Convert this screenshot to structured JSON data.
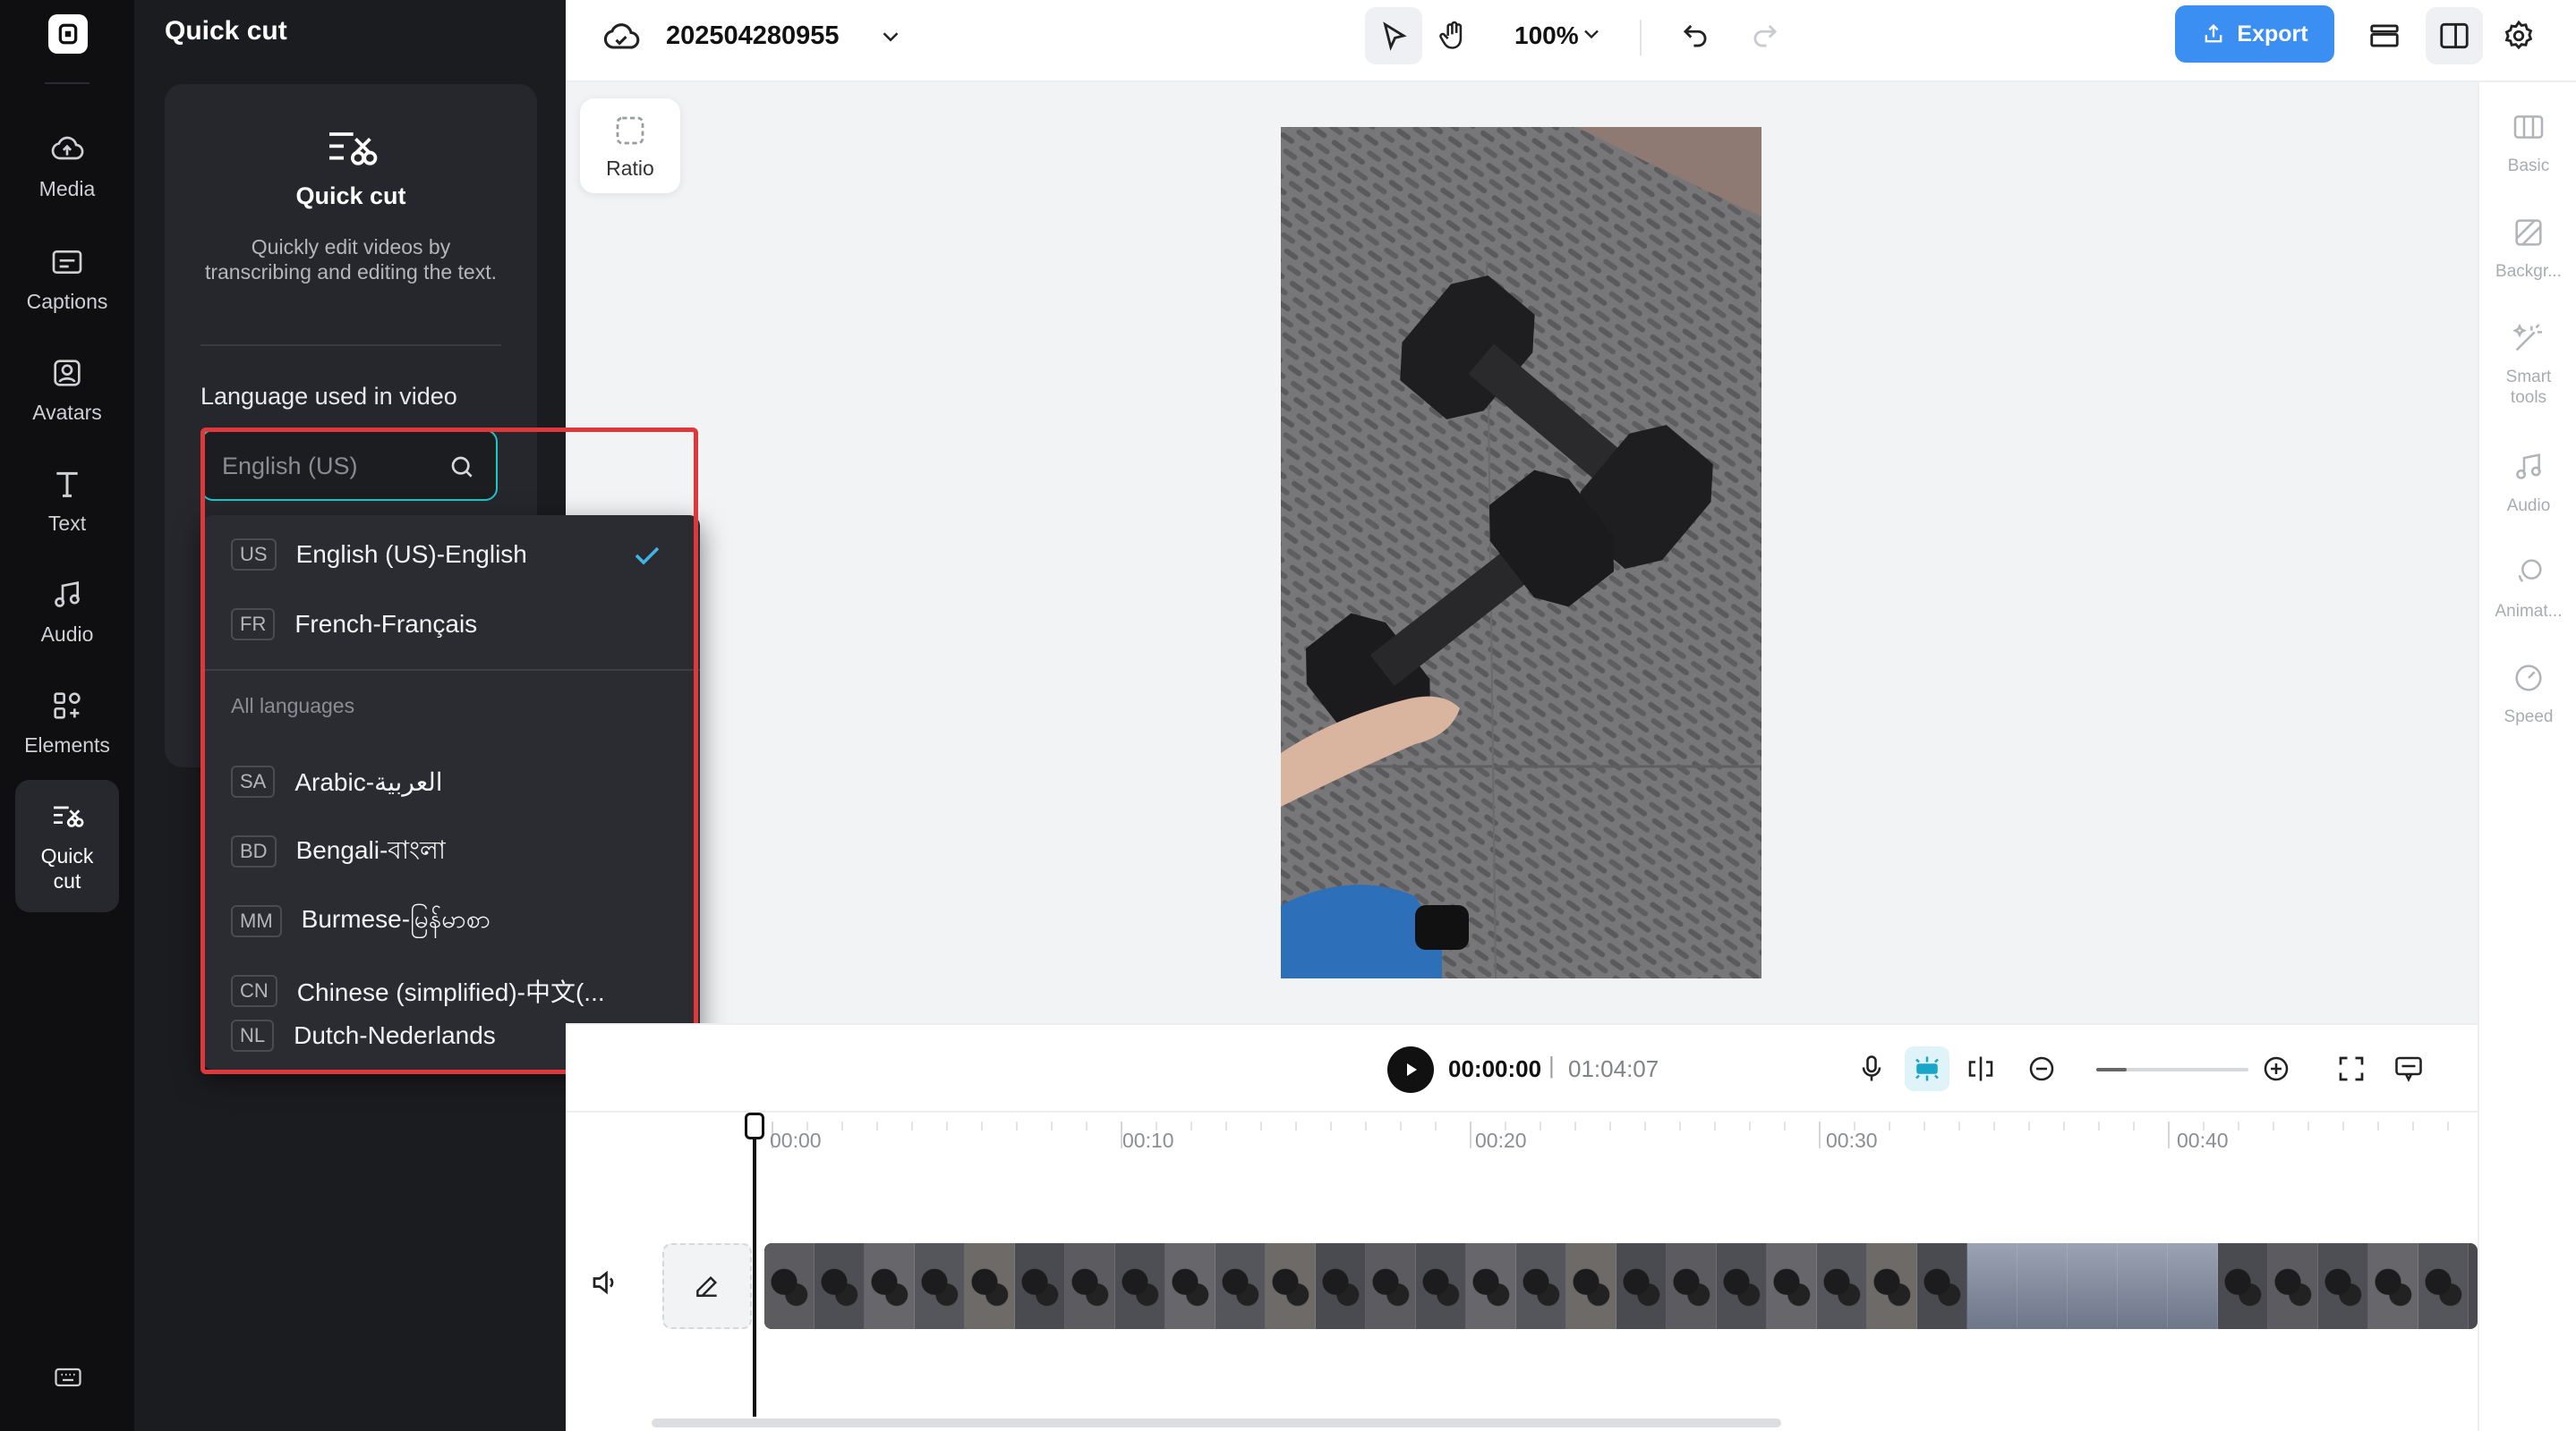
{
  "rail": {
    "items": [
      {
        "label": "Media",
        "icon": "cloud-upload-icon"
      },
      {
        "label": "Captions",
        "icon": "captions-icon"
      },
      {
        "label": "Avatars",
        "icon": "avatar-icon"
      },
      {
        "label": "Text",
        "icon": "text-icon"
      },
      {
        "label": "Audio",
        "icon": "music-icon"
      },
      {
        "label": "Elements",
        "icon": "elements-icon"
      },
      {
        "label": "Quick cut",
        "icon": "quick-cut-icon"
      }
    ],
    "active": "Quick cut"
  },
  "panel": {
    "title": "Quick cut",
    "card_title": "Quick cut",
    "card_description": "Quickly edit videos by transcribing and editing the text.",
    "language_label": "Language used in video",
    "search_placeholder": "English (US)"
  },
  "dropdown": {
    "recent": [
      {
        "code": "US",
        "label": "English (US)-English",
        "selected": true
      },
      {
        "code": "FR",
        "label": "French-Français",
        "selected": false
      }
    ],
    "section_label": "All languages",
    "all": [
      {
        "code": "SA",
        "label": "Arabic-العربية"
      },
      {
        "code": "BD",
        "label": "Bengali-বাংলা"
      },
      {
        "code": "MM",
        "label": "Burmese-မြန်မာစာ"
      },
      {
        "code": "CN",
        "label": "Chinese (simplified)-中文(..."
      },
      {
        "code": "NL",
        "label": "Dutch-Nederlands"
      }
    ]
  },
  "topbar": {
    "project_title": "202504280955",
    "zoom": "100%",
    "export_label": "Export"
  },
  "canvas": {
    "ratio_label": "Ratio"
  },
  "right_sidebar": {
    "items": [
      {
        "label": "Basic",
        "icon": "basic-icon"
      },
      {
        "label": "Backgr...",
        "icon": "background-icon"
      },
      {
        "label": "Smart tools",
        "icon": "magic-wand-icon"
      },
      {
        "label": "Audio",
        "icon": "music-icon"
      },
      {
        "label": "Animat...",
        "icon": "animation-icon"
      },
      {
        "label": "Speed",
        "icon": "speed-icon"
      }
    ]
  },
  "player": {
    "current_time": "00:00:00",
    "separator": "|",
    "total_time": "01:04:07",
    "zoom_fraction": 0.2
  },
  "timeline": {
    "ticks": [
      "00:00",
      "00:10",
      "00:20",
      "00:30",
      "00:40"
    ]
  },
  "colors": {
    "accent": "#3b8ff2",
    "focus": "#1ec6c6",
    "highlight": "#e0373a",
    "check": "#3fb6e6"
  }
}
